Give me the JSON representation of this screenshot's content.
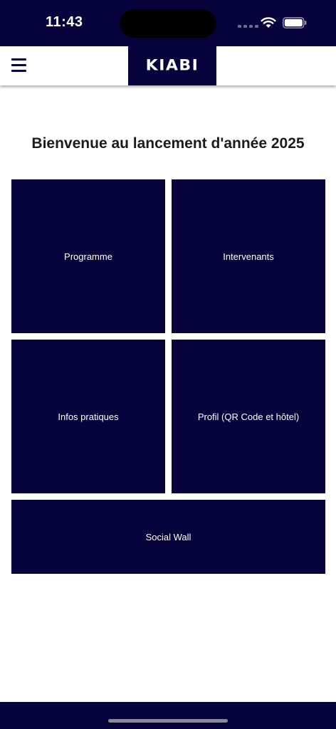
{
  "status_bar": {
    "time": "11:43",
    "icons": [
      "signal-dots",
      "wifi-icon",
      "battery-icon"
    ]
  },
  "header": {
    "logo_text": "KIABI",
    "menu_icon": "hamburger-menu-icon"
  },
  "main": {
    "title": "Bienvenue au lancement d'année 2025",
    "tiles": [
      {
        "label": "Programme"
      },
      {
        "label": "Intervenants"
      },
      {
        "label": "Infos pratiques"
      },
      {
        "label": "Profil (QR Code et hôtel)"
      },
      {
        "label": "Social Wall"
      }
    ]
  },
  "colors": {
    "brand_navy": "#06023c",
    "background": "#ffffff",
    "title_text": "#1c1c1c"
  }
}
